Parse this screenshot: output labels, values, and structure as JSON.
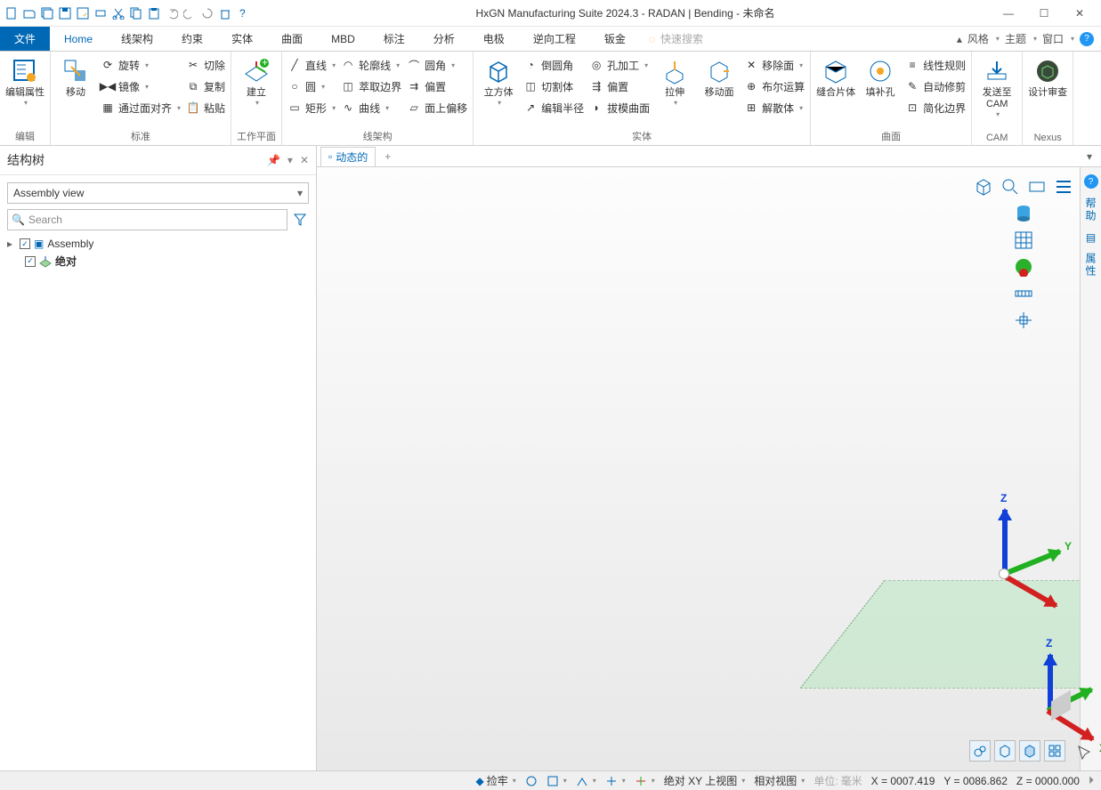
{
  "title": "HxGN Manufacturing Suite 2024.3 - RADAN | Bending - 未命名",
  "tabs": {
    "file": "文件",
    "home": "Home",
    "wireframe": "线架构",
    "constraint": "约束",
    "solid": "实体",
    "surface": "曲面",
    "mbd": "MBD",
    "annotate": "标注",
    "analyze": "分析",
    "electrode": "电极",
    "reverse": "逆向工程",
    "sheetmetal": "钣金",
    "quick_search": "快速搜索",
    "style": "风格",
    "theme": "主题",
    "window": "窗口"
  },
  "ribbon": {
    "edit": {
      "label": "编辑",
      "props": "编辑属性"
    },
    "std": {
      "label": "标准",
      "move": "移动",
      "rotate": "旋转",
      "mirror": "镜像",
      "align": "通过面对齐",
      "cut": "切除",
      "copy": "复制",
      "paste": "粘贴"
    },
    "workplane": {
      "label": "工作平面",
      "create": "建立"
    },
    "wire": {
      "label": "线架构",
      "line": "直线",
      "circle": "圆",
      "rect": "矩形",
      "profile": "轮廓线",
      "edge": "萃取边界",
      "curve": "曲线",
      "fillet": "圆角",
      "offset": "偏置",
      "facecurve": "面上偏移"
    },
    "solid": {
      "label": "实体",
      "cube": "立方体",
      "round": "倒圆角",
      "slice": "切割体",
      "editr": "编辑半径",
      "hole": "孔加工",
      "off2": "偏置",
      "moldcurve": "拔模曲面",
      "extrude": "拉伸",
      "movesurf": "移动面",
      "delface": "移除面",
      "bool": "布尔运算",
      "disperse": "解散体"
    },
    "surface": {
      "label": "曲面",
      "sew": "缝合片体",
      "fillhole": "填补孔",
      "linrule": "线性规则",
      "autofix": "自动修剪",
      "simplify": "简化边界"
    },
    "cam": {
      "label": "CAM",
      "send": "发送至\nCAM"
    },
    "nexus": {
      "label": "Nexus",
      "review": "设计审查"
    }
  },
  "panel": {
    "title": "结构树",
    "view": "Assembly view",
    "search_ph": "Search",
    "assembly": "Assembly",
    "absolute": "绝对"
  },
  "doc": {
    "dynamic": "动态的"
  },
  "siderail": {
    "help": "帮助",
    "props": "属性"
  },
  "axis": {
    "x": "X",
    "y": "Y",
    "z": "Z"
  },
  "status": {
    "snap": "捡牢",
    "absview": "绝对 XY 上视图",
    "relview": "相对视图",
    "unit_lbl": "单位:",
    "unit": "毫米",
    "x": "X = 0007.419",
    "y": "Y = 0086.862",
    "z": "Z = 0000.000"
  }
}
